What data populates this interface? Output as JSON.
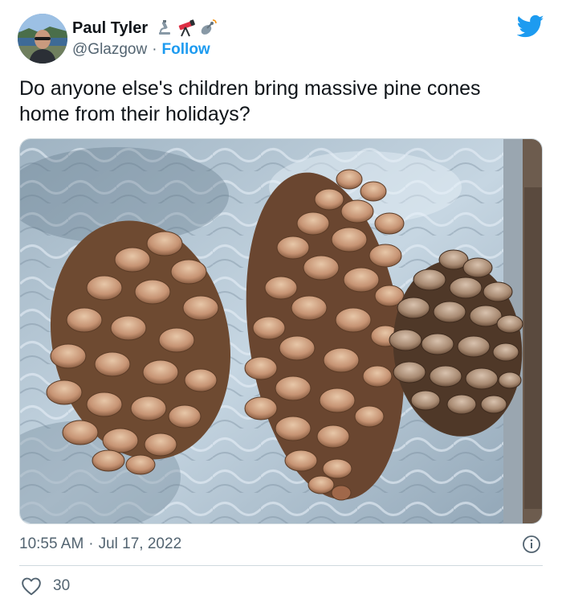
{
  "author": {
    "display_name": "Paul Tyler",
    "handle": "@Glazgow",
    "separator": "·",
    "follow_label": "Follow",
    "name_emojis": [
      "microscope-icon",
      "telescope-icon",
      "satellite-icon"
    ]
  },
  "tweet": {
    "text": "Do anyone else's children bring massive pine cones home from their holidays?",
    "media": {
      "kind": "photo",
      "subject": "three pine cones on a textured glass table"
    }
  },
  "meta": {
    "time": "10:55 AM",
    "separator": "·",
    "date": "Jul 17, 2022"
  },
  "engagement": {
    "likes": "30"
  },
  "colors": {
    "brand": "#1d9bf0",
    "text_primary": "#0f1419",
    "text_secondary": "#536471",
    "border": "#cfd9de",
    "like_icon": "#536471"
  }
}
